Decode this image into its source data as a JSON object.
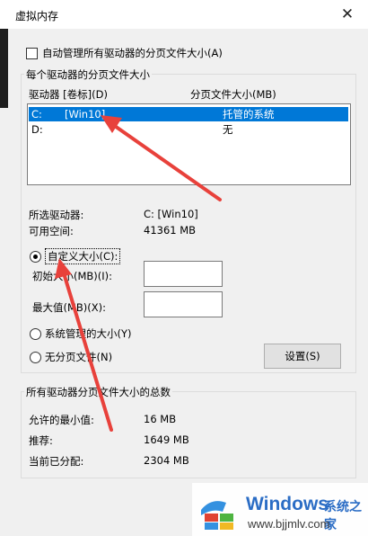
{
  "window": {
    "title": "虚拟内存",
    "close_glyph": "✕"
  },
  "auto_manage": {
    "label": "自动管理所有驱动器的分页文件大小(A)",
    "checked": false
  },
  "per_drive_group": {
    "title": "每个驱动器的分页文件大小",
    "col_drive": "驱动器 [卷标](D)",
    "col_size": "分页文件大小(MB)",
    "drives": [
      {
        "drive": "C:",
        "label": "[Win10]",
        "size": "托管的系统",
        "selected": true
      },
      {
        "drive": "D:",
        "label": "",
        "size": "无",
        "selected": false
      }
    ],
    "selected_drive_label": "所选驱动器:",
    "selected_drive_value": "C:  [Win10]",
    "free_space_label": "可用空间:",
    "free_space_value": "41361 MB",
    "options": {
      "custom": "自定义大小(C):",
      "initial_size": "初始大小(MB)(I):",
      "max_size": "最大值(MB)(X):",
      "system_managed": "系统管理的大小(Y)",
      "no_paging": "无分页文件(N)",
      "selected": "custom"
    },
    "initial_value": "",
    "max_value": "",
    "set_button": "设置(S)"
  },
  "totals_group": {
    "title": "所有驱动器分页文件大小的总数",
    "min_label": "允许的最小值:",
    "min_value": "16 MB",
    "recommended_label": "推荐:",
    "recommended_value": "1649 MB",
    "allocated_label": "当前已分配:",
    "allocated_value": "2304 MB"
  },
  "watermark": {
    "brand": "Windows",
    "cn": "系统之家",
    "url": "www.bjjmlv.com"
  },
  "colors": {
    "selection": "#0078d7",
    "arrow": "#e8413b",
    "brand": "#2468c4"
  }
}
